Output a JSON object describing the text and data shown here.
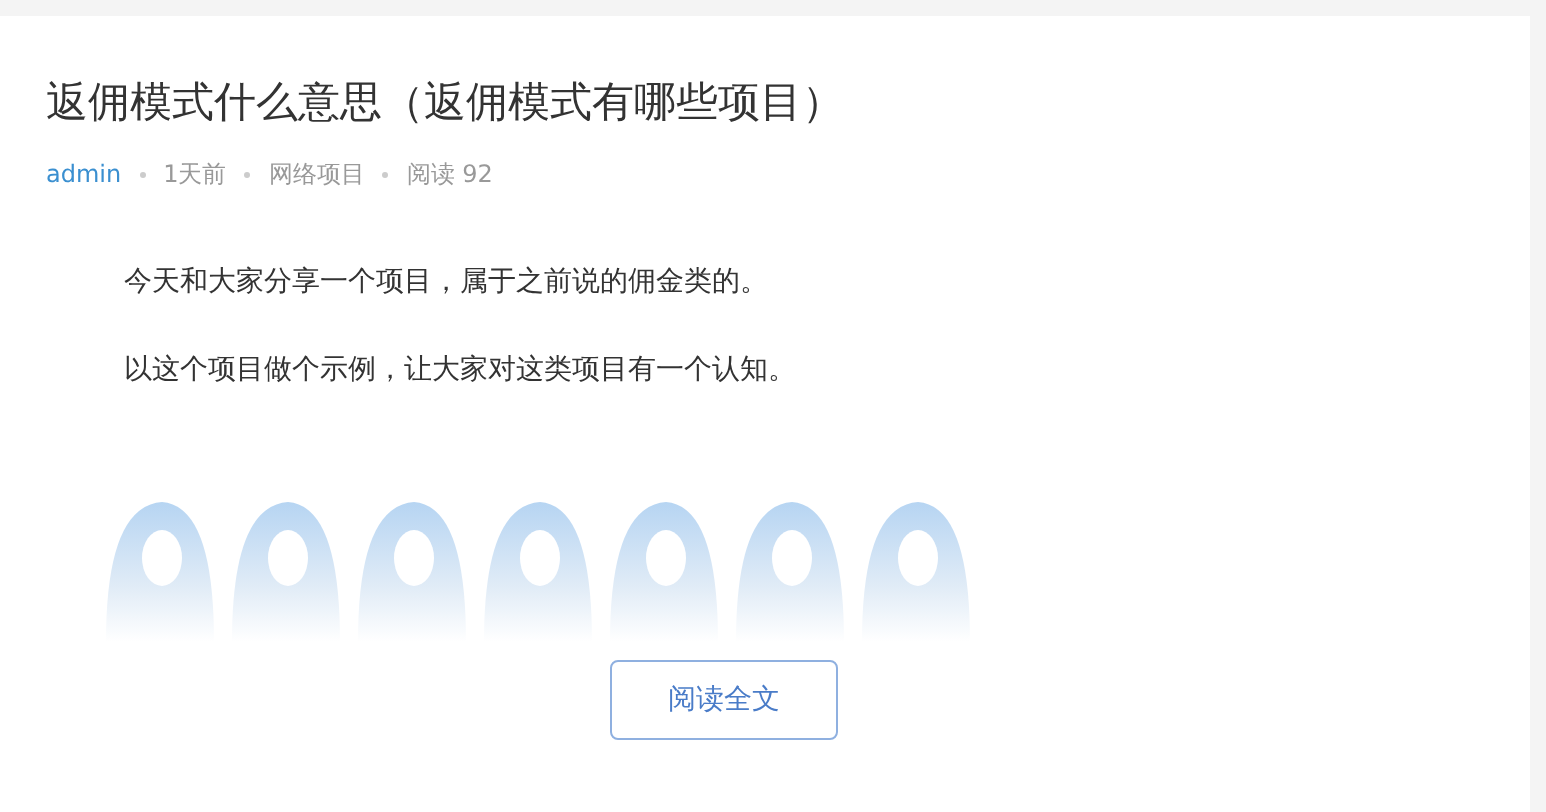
{
  "article": {
    "title": "返佣模式什么意思（返佣模式有哪些项目）",
    "meta": {
      "author": "admin",
      "time": "1天前",
      "category": "网络项目",
      "views": "阅读 92"
    },
    "paragraphs": [
      "今天和大家分享一个项目，属于之前说的佣金类的。",
      "以这个项目做个示例，让大家对这类项目有一个认知。"
    ],
    "read_more": "阅读全文"
  }
}
